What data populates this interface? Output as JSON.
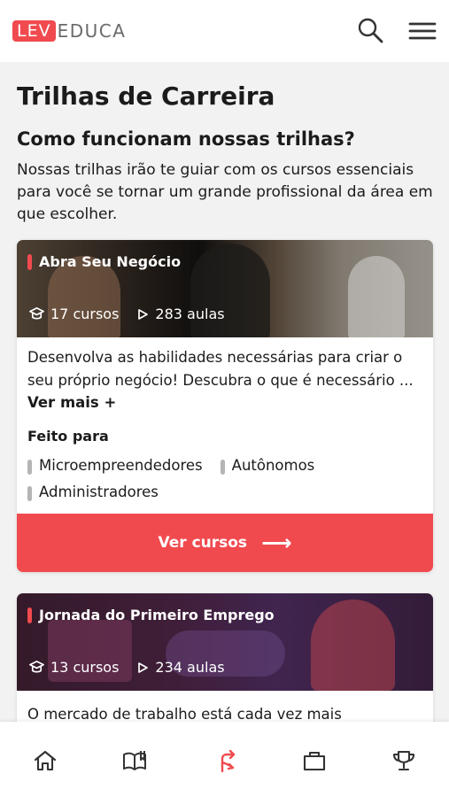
{
  "header": {
    "logo_part1": "LEV",
    "logo_part2": "EDUCA",
    "icons": [
      "search-icon",
      "menu-icon"
    ]
  },
  "page": {
    "title": "Trilhas de Carreira",
    "subtitle": "Como funcionam nossas trilhas?",
    "intro": "Nossas trilhas irão te guiar com os cursos essenciais para você se tornar um grande profissional da área em que escolher."
  },
  "cards": [
    {
      "title": "Abra Seu Negócio",
      "courses": "17 cursos",
      "lessons": "283 aulas",
      "description": "Desenvolva as habilidades necessárias para criar o seu próprio negócio! Descubra o que é necessário ...",
      "more_label": "Ver mais +",
      "audience_title": "Feito para",
      "audience": [
        "Microempreendedores",
        "Autônomos",
        "Administradores"
      ],
      "cta_label": "Ver cursos",
      "cta_arrow": "⟶"
    },
    {
      "title": "Jornada do Primeiro Emprego",
      "courses": "13 cursos",
      "lessons": "234 aulas",
      "description": "O mercado de trabalho está cada vez mais"
    }
  ],
  "bottom_nav": [
    "home-icon",
    "book-icon",
    "career-route-icon",
    "briefcase-icon",
    "trophy-icon"
  ],
  "colors": {
    "accent": "#f04a4f",
    "background": "#f2f2f2",
    "text": "#1b1b1b"
  }
}
